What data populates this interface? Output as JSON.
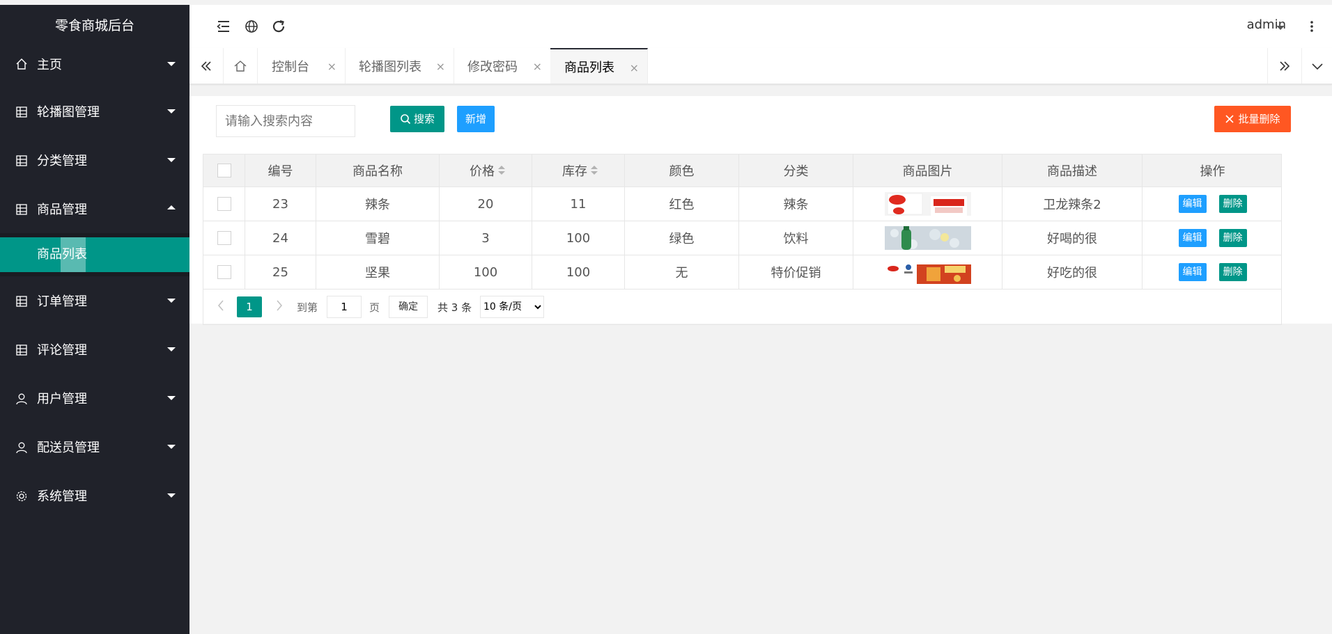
{
  "app": {
    "title": "零食商城后台"
  },
  "sidebar": {
    "items": [
      {
        "label": "主页",
        "icon": "home-icon",
        "open": false
      },
      {
        "label": "轮播图管理",
        "icon": "grid-icon",
        "open": false
      },
      {
        "label": "分类管理",
        "icon": "grid-icon",
        "open": false
      },
      {
        "label": "商品管理",
        "icon": "grid-icon",
        "open": true,
        "children": [
          {
            "label": "商品列表",
            "active": true
          }
        ]
      },
      {
        "label": "订单管理",
        "icon": "grid-icon",
        "open": false
      },
      {
        "label": "评论管理",
        "icon": "grid-icon",
        "open": false
      },
      {
        "label": "用户管理",
        "icon": "user-icon",
        "open": false
      },
      {
        "label": "配送员管理",
        "icon": "user-icon",
        "open": false
      },
      {
        "label": "系统管理",
        "icon": "gear-icon",
        "open": false
      }
    ]
  },
  "header": {
    "icons": [
      "menu-fold-icon",
      "globe-icon",
      "refresh-icon"
    ],
    "user": "admin",
    "more_icon": "more-vertical-icon"
  },
  "tabs": {
    "items": [
      {
        "label": "控制台",
        "active": false
      },
      {
        "label": "轮播图列表",
        "active": false
      },
      {
        "label": "修改密码",
        "active": false
      },
      {
        "label": "商品列表",
        "active": true
      }
    ],
    "close_glyph": "×"
  },
  "toolbar": {
    "search_placeholder": "请输入搜索内容",
    "search_label": "搜索",
    "add_label": "新增",
    "batch_delete_label": "批量删除"
  },
  "table": {
    "headers": [
      "编号",
      "商品名称",
      "价格",
      "库存",
      "颜色",
      "分类",
      "商品图片",
      "商品描述",
      "操作"
    ],
    "rows": [
      {
        "id": "23",
        "name": "辣条",
        "price": "20",
        "stock": "11",
        "color": "红色",
        "category": "辣条",
        "desc": "卫龙辣条2"
      },
      {
        "id": "24",
        "name": "雪碧",
        "price": "3",
        "stock": "100",
        "color": "绿色",
        "category": "饮料",
        "desc": "好喝的很"
      },
      {
        "id": "25",
        "name": "坚果",
        "price": "100",
        "stock": "100",
        "color": "无",
        "category": "特价促销",
        "desc": "好吃的很"
      }
    ],
    "edit_label": "编辑",
    "delete_label": "删除"
  },
  "pager": {
    "current": "1",
    "goto_label": "到第",
    "goto_value": "1",
    "page_label": "页",
    "confirm_label": "确定",
    "total_label": "共 3 条",
    "page_size": "10 条/页"
  },
  "colors": {
    "sidebar": "#20222a",
    "primary": "#009688",
    "blue": "#1e9fff",
    "danger": "#ff5722"
  }
}
